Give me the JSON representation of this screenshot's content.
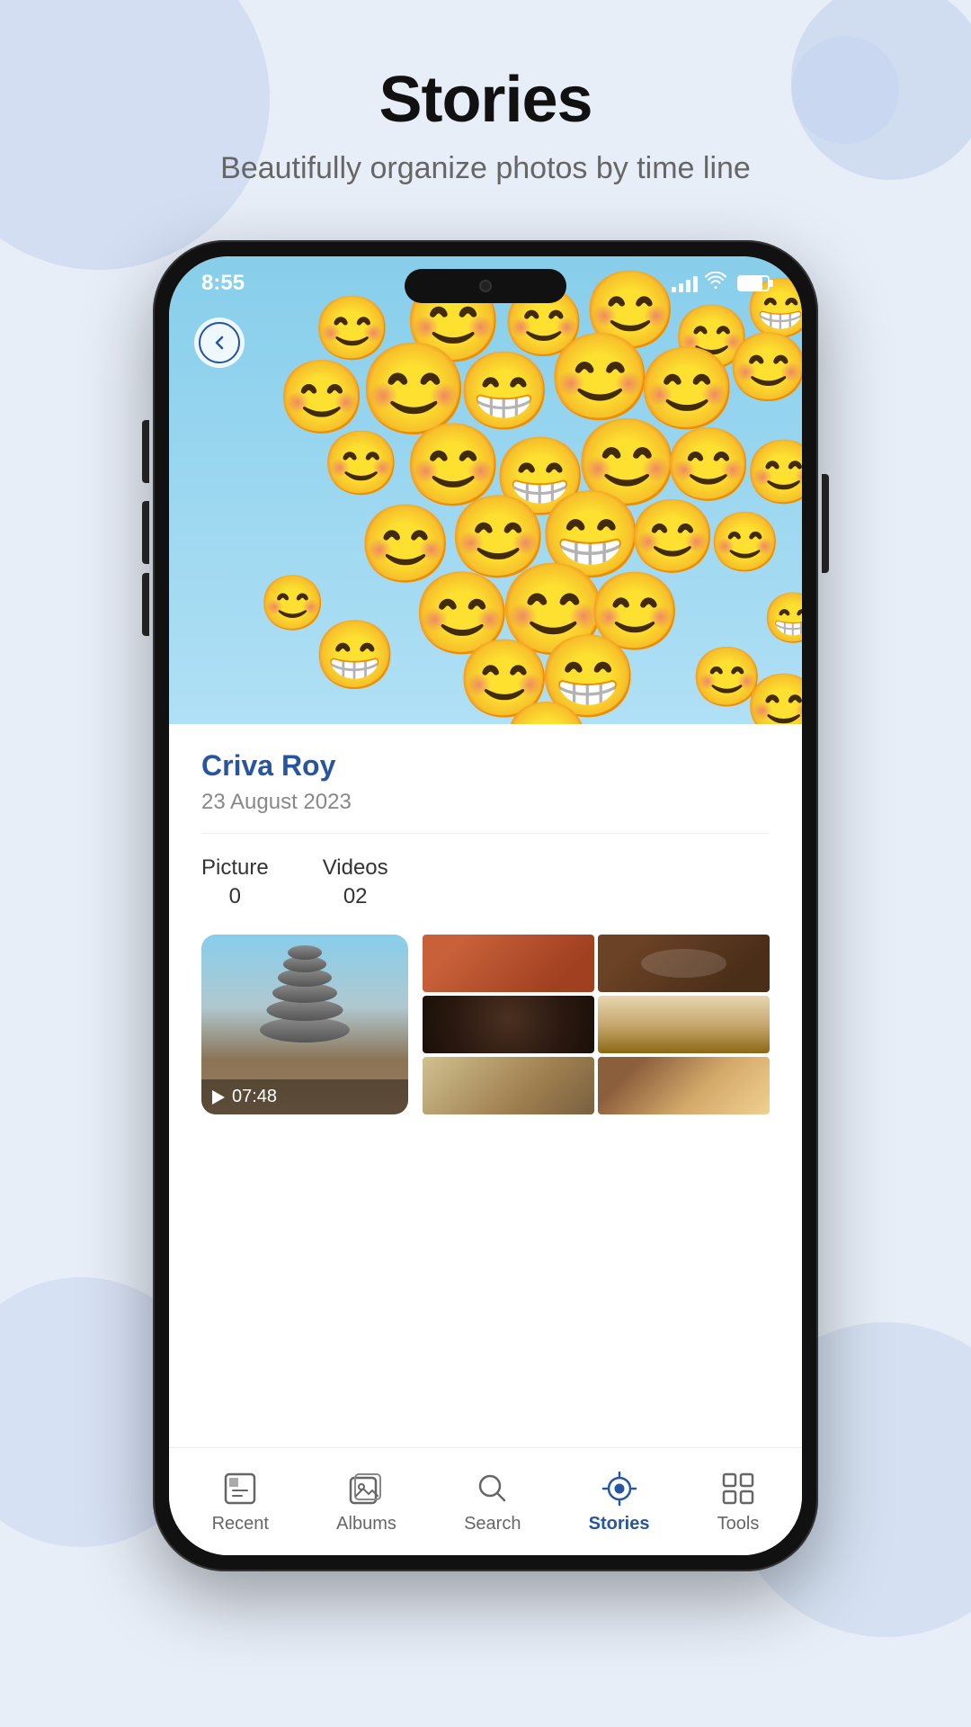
{
  "page": {
    "title": "Stories",
    "subtitle": "Beautifully organize photos by time line"
  },
  "phone": {
    "status_bar": {
      "time": "8:55"
    },
    "story": {
      "name": "Criva Roy",
      "date": "23 August 2023",
      "picture_label": "Picture",
      "picture_count": "0",
      "videos_label": "Videos",
      "videos_count": "02",
      "video_duration": "07:48"
    },
    "nav": {
      "items": [
        {
          "label": "Recent",
          "icon": "recent-icon",
          "active": false
        },
        {
          "label": "Albums",
          "icon": "albums-icon",
          "active": false
        },
        {
          "label": "Search",
          "icon": "search-icon",
          "active": false
        },
        {
          "label": "Stories",
          "icon": "stories-icon",
          "active": true
        },
        {
          "label": "Tools",
          "icon": "tools-icon",
          "active": false
        }
      ]
    }
  },
  "colors": {
    "brand_blue": "#2855a0",
    "background": "#e8eef8"
  }
}
